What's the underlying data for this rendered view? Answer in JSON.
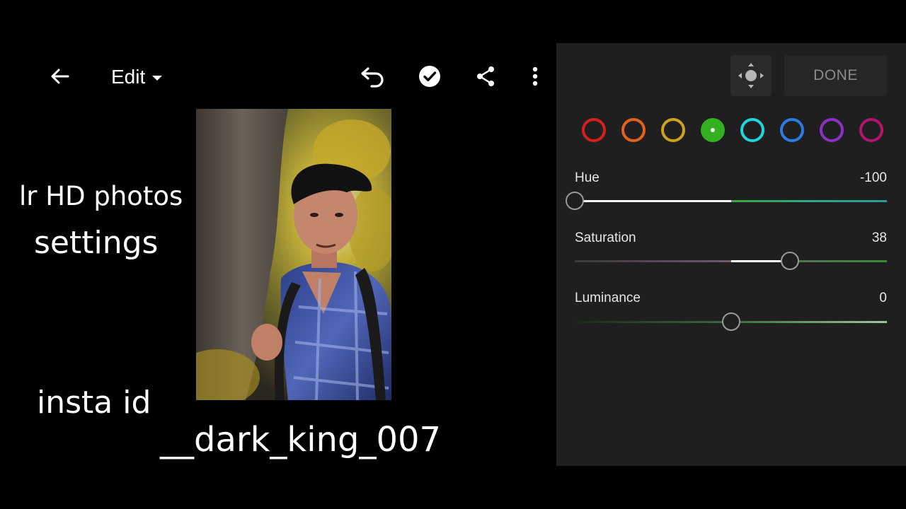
{
  "toolbar": {
    "edit_label": "Edit",
    "icons": [
      "back-arrow-icon",
      "undo-icon",
      "checkmark-icon",
      "share-icon",
      "more-vert-icon"
    ]
  },
  "overlay": {
    "line1": "lr HD photos",
    "line2": "settings",
    "line3": "insta id",
    "line4": "__dark_king_007"
  },
  "panel": {
    "done_label": "DONE",
    "target_icon": "targeted-adjustment-icon",
    "swatches": [
      {
        "name": "red",
        "color": "#d42020",
        "selected": false
      },
      {
        "name": "orange",
        "color": "#e0621c",
        "selected": false
      },
      {
        "name": "yellow",
        "color": "#c9a41c",
        "selected": false
      },
      {
        "name": "green",
        "color": "#34b022",
        "selected": true
      },
      {
        "name": "aqua",
        "color": "#1fd6dc",
        "selected": false
      },
      {
        "name": "blue",
        "color": "#2b7be3",
        "selected": false
      },
      {
        "name": "purple",
        "color": "#8a31c8",
        "selected": false
      },
      {
        "name": "magenta",
        "color": "#b21470",
        "selected": false
      }
    ],
    "sliders": [
      {
        "label": "Hue",
        "value": "-100",
        "numeric": -100,
        "min": -100,
        "max": 100
      },
      {
        "label": "Saturation",
        "value": "38",
        "numeric": 38,
        "min": -100,
        "max": 100
      },
      {
        "label": "Luminance",
        "value": "0",
        "numeric": 0,
        "min": -100,
        "max": 100
      }
    ]
  }
}
